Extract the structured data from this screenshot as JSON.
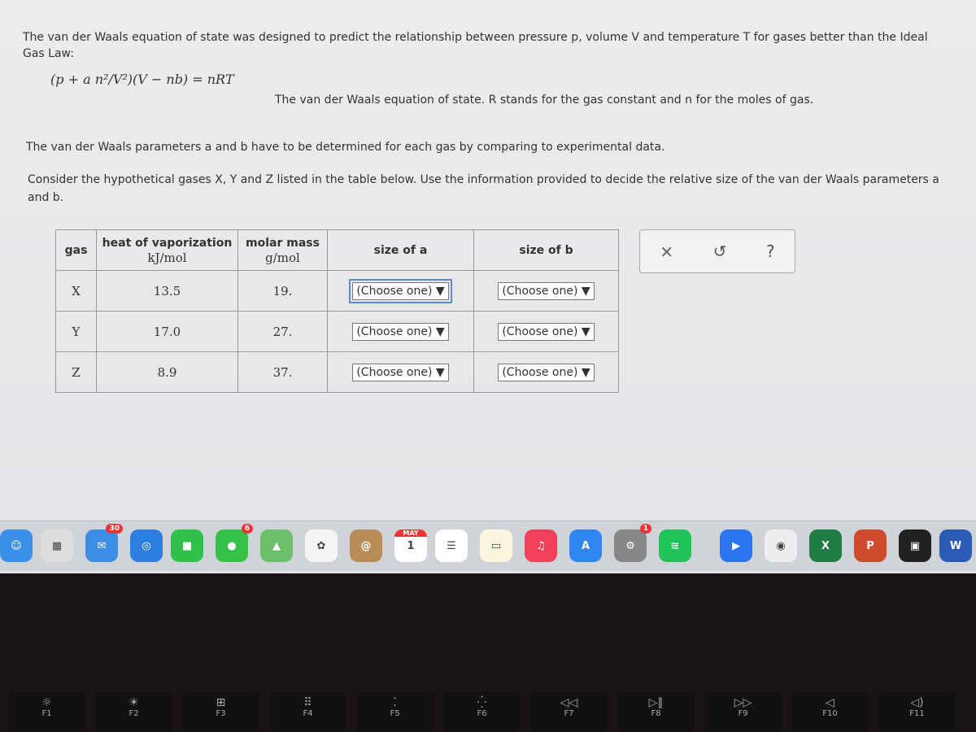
{
  "intro": {
    "line1": "The van der Waals equation of state was designed to predict the relationship between pressure p, volume V and temperature T for gases better than the Ideal",
    "line2": "Gas Law:"
  },
  "equation": {
    "formula": "(p + a n²/V²)(V − nb) = nRT",
    "caption": "The van der Waals equation of state. R stands for the gas constant and n for the moles of gas."
  },
  "para2": "The van der Waals parameters a and b have to be determined for each gas by comparing to experimental data.",
  "para3": {
    "line1": "Consider the hypothetical gases X, Y and Z listed in the table below. Use the information provided to decide the relative size of the van der Waals parameters a",
    "line2": "and b."
  },
  "table": {
    "headers": [
      {
        "label": "gas",
        "unit": ""
      },
      {
        "label": "heat of vaporization",
        "unit": "kJ/mol"
      },
      {
        "label": "molar mass",
        "unit": "g/mol"
      },
      {
        "label": "size of a",
        "unit": ""
      },
      {
        "label": "size of b",
        "unit": ""
      }
    ],
    "rows": [
      {
        "gas": "X",
        "heat": "13.5",
        "mass": "19.",
        "a": "(Choose one) ▼",
        "b": "(Choose one) ▼"
      },
      {
        "gas": "Y",
        "heat": "17.0",
        "mass": "27.",
        "a": "(Choose one) ▼",
        "b": "(Choose one) ▼"
      },
      {
        "gas": "Z",
        "heat": "8.9",
        "mass": "37.",
        "a": "(Choose one) ▼",
        "b": "(Choose one) ▼"
      }
    ]
  },
  "tools": {
    "close": "×",
    "undo": "↺",
    "help": "?"
  },
  "dock": [
    {
      "name": "finder",
      "bg": "#3a8fe8",
      "g": "☺"
    },
    {
      "name": "launchpad",
      "bg": "#ddd",
      "g": "▦"
    },
    {
      "name": "mail",
      "bg": "#3b8de6",
      "g": "✉",
      "badge": "30"
    },
    {
      "name": "safari",
      "bg": "#2c7fe0",
      "g": "◎"
    },
    {
      "name": "facetime",
      "bg": "#2fc24a",
      "g": "■"
    },
    {
      "name": "messages",
      "bg": "#34c348",
      "g": "●",
      "badge": "6"
    },
    {
      "name": "maps",
      "bg": "#6cbf6a",
      "g": "▲"
    },
    {
      "name": "photos",
      "bg": "#f4f4f4",
      "g": "✿"
    },
    {
      "name": "contacts",
      "bg": "#b98c5a",
      "g": "@"
    },
    {
      "name": "calendar",
      "bg": "#fff",
      "g": "1",
      "top": "MAY"
    },
    {
      "name": "reminders",
      "bg": "#fff",
      "g": "☰"
    },
    {
      "name": "notes",
      "bg": "#fbf6e0",
      "g": "▭"
    },
    {
      "name": "music",
      "bg": "#f0405a",
      "g": "♫"
    },
    {
      "name": "app-store",
      "bg": "#2f86f0",
      "g": "A"
    },
    {
      "name": "system-preferences",
      "bg": "#888",
      "g": "⚙",
      "badge": "1"
    },
    {
      "name": "spotify",
      "bg": "#1fc35a",
      "g": "≋"
    },
    {
      "name": "zoom",
      "bg": "#2d75f0",
      "g": "▶"
    },
    {
      "name": "chrome",
      "bg": "#eee",
      "g": "◉"
    },
    {
      "name": "excel",
      "bg": "#1f7a44",
      "g": "X"
    },
    {
      "name": "powerpoint",
      "bg": "#d04a2c",
      "g": "P"
    },
    {
      "name": "printer",
      "bg": "#222",
      "g": "▣"
    },
    {
      "name": "word",
      "bg": "#2a5bb5",
      "g": "W"
    }
  ],
  "keys": [
    {
      "label": "F1",
      "g": "☼"
    },
    {
      "label": "F2",
      "g": "☀"
    },
    {
      "label": "F3",
      "g": "⊞"
    },
    {
      "label": "F4",
      "g": "⠿"
    },
    {
      "label": "F5",
      "g": "⁚"
    },
    {
      "label": "F6",
      "g": "⁛"
    },
    {
      "label": "F7",
      "g": "◁◁"
    },
    {
      "label": "F8",
      "g": "▷∥"
    },
    {
      "label": "F9",
      "g": "▷▷"
    },
    {
      "label": "F10",
      "g": "◁"
    },
    {
      "label": "F11",
      "g": "◁)"
    }
  ]
}
